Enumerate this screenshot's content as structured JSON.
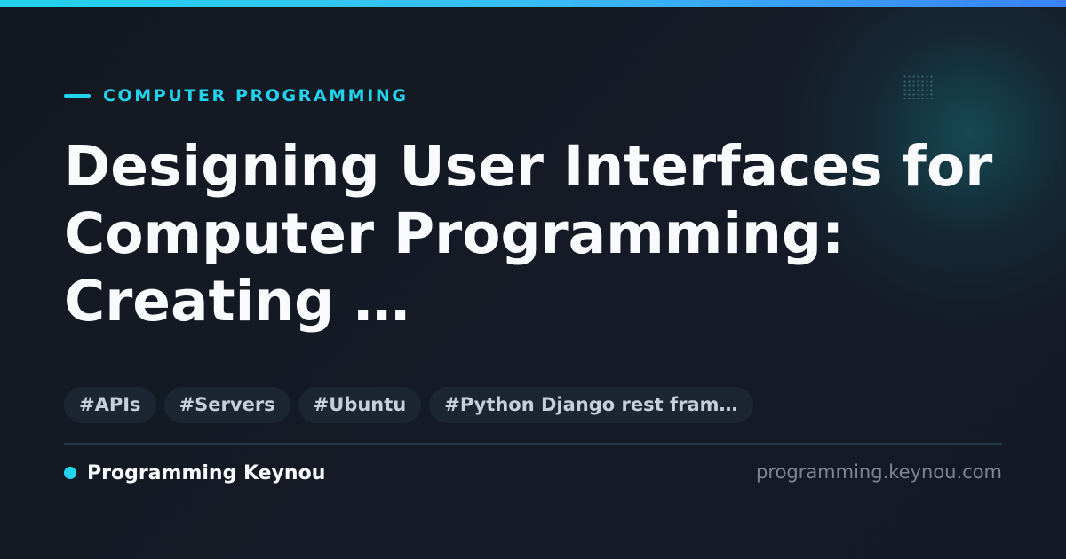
{
  "category": "COMPUTER PROGRAMMING",
  "title": "Designing User Interfaces for Computer Programming: Creating …",
  "tags": [
    "#APIs",
    "#Servers",
    "#Ubuntu",
    "#Python Django rest fram…"
  ],
  "footer": {
    "brand": "Programming Keynou",
    "url": "programming.keynou.com"
  },
  "colors": {
    "accent": "#22d3ee",
    "background": "#141a24",
    "title": "#f8fafc",
    "tag_background": "#1c2633",
    "tag_text": "#c7cfdb",
    "url_text": "#7c8796"
  }
}
